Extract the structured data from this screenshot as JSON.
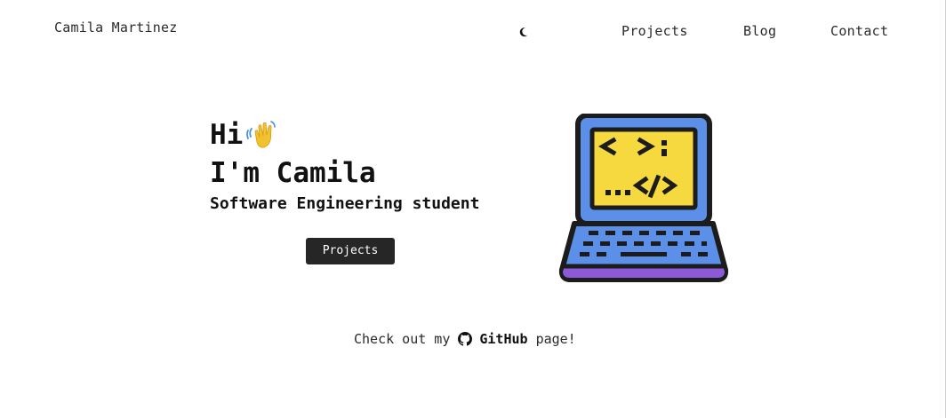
{
  "header": {
    "brand": "Camila Martinez",
    "theme_toggle_icon": "moon-icon",
    "nav": [
      "Projects",
      "Blog",
      "Contact"
    ]
  },
  "hero": {
    "greeting": "Hi",
    "wave_icon": "waving-hand-icon",
    "name_line": "I'm Camila",
    "subtitle": "Software Engineering student",
    "button_label": "Projects",
    "illustration_icon": "laptop-code-icon"
  },
  "footer": {
    "prefix": "Check out my",
    "link_label": "GitHub",
    "suffix": "page!",
    "link_icon": "github-icon"
  },
  "colors": {
    "button_bg": "#262626",
    "laptop_blue": "#5b8fe8",
    "laptop_screen": "#f6d83f",
    "laptop_base": "#8c5ad9",
    "outline": "#1c1c1c"
  }
}
